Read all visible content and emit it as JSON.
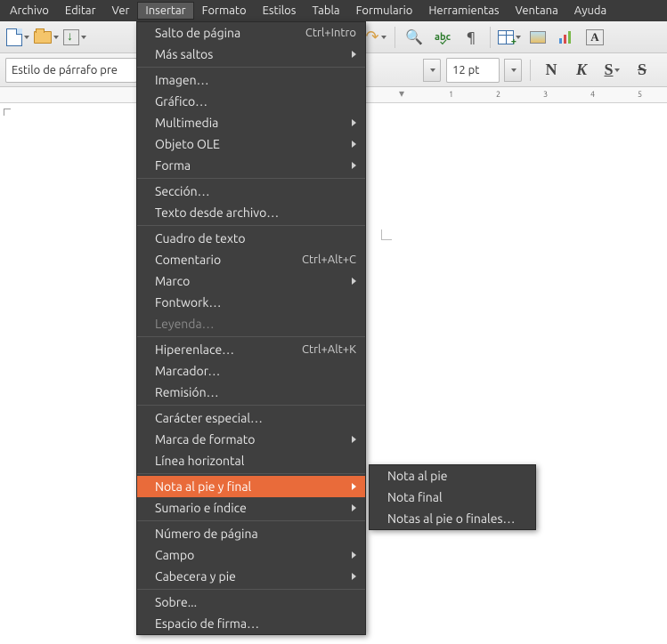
{
  "menubar": {
    "items": [
      {
        "label": "Archivo"
      },
      {
        "label": "Editar"
      },
      {
        "label": "Ver"
      },
      {
        "label": "Insertar"
      },
      {
        "label": "Formato"
      },
      {
        "label": "Estilos"
      },
      {
        "label": "Tabla"
      },
      {
        "label": "Formulario"
      },
      {
        "label": "Herramientas"
      },
      {
        "label": "Ventana"
      },
      {
        "label": "Ayuda"
      }
    ]
  },
  "toolbar2": {
    "style_combo": "Estilo de párrafo pre",
    "font_size": "12 pt",
    "bold": "N",
    "italic": "K",
    "underline": "S",
    "strike": "S"
  },
  "ruler": {
    "marks": [
      "1",
      "2",
      "3",
      "4",
      "5"
    ]
  },
  "insert_menu": {
    "items": [
      {
        "label": "Salto de página",
        "accel": "Ctrl+Intro"
      },
      {
        "label": "Más saltos",
        "submenu": true
      },
      {
        "sep": true
      },
      {
        "label": "Imagen…"
      },
      {
        "label": "Gráfico…"
      },
      {
        "label": "Multimedia",
        "submenu": true
      },
      {
        "label": "Objeto OLE",
        "submenu": true
      },
      {
        "label": "Forma",
        "submenu": true
      },
      {
        "sep": true
      },
      {
        "label": "Sección…"
      },
      {
        "label": "Texto desde archivo…"
      },
      {
        "sep": true
      },
      {
        "label": "Cuadro de texto"
      },
      {
        "label": "Comentario",
        "accel": "Ctrl+Alt+C"
      },
      {
        "label": "Marco",
        "submenu": true
      },
      {
        "label": "Fontwork…"
      },
      {
        "label": "Leyenda…",
        "disabled": true
      },
      {
        "sep": true
      },
      {
        "label": "Hiperenlace…",
        "accel": "Ctrl+Alt+K"
      },
      {
        "label": "Marcador…"
      },
      {
        "label": "Remisión…"
      },
      {
        "sep": true
      },
      {
        "label": "Carácter especial…"
      },
      {
        "label": "Marca de formato",
        "submenu": true
      },
      {
        "label": "Línea horizontal"
      },
      {
        "sep": true
      },
      {
        "label": "Nota al pie y final",
        "submenu": true,
        "highlight": true
      },
      {
        "label": "Sumario e índice",
        "submenu": true
      },
      {
        "sep": true
      },
      {
        "label": "Número de página"
      },
      {
        "label": "Campo",
        "submenu": true
      },
      {
        "label": "Cabecera y pie",
        "submenu": true
      },
      {
        "sep": true
      },
      {
        "label": "Sobre..."
      },
      {
        "label": "Espacio de firma…"
      }
    ]
  },
  "footnote_submenu": {
    "items": [
      {
        "label": "Nota al pie"
      },
      {
        "label": "Nota final"
      },
      {
        "label": "Notas al pie o finales…"
      }
    ]
  }
}
